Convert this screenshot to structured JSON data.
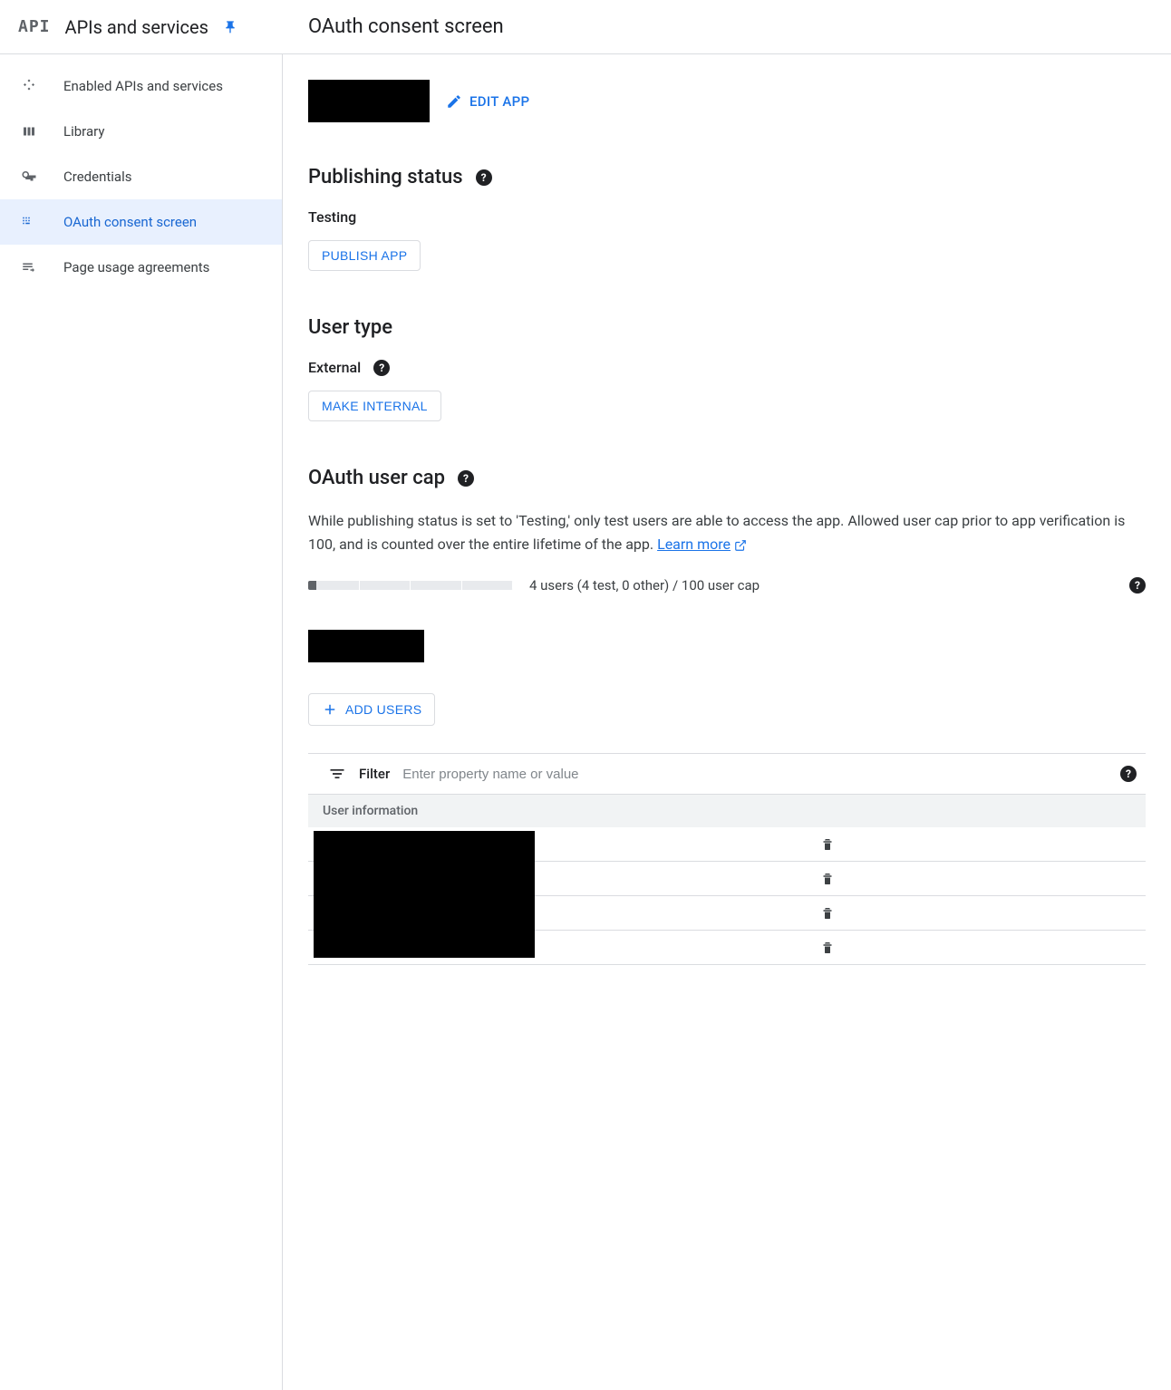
{
  "header": {
    "logo": "API",
    "title": "APIs and services",
    "page_title": "OAuth consent screen"
  },
  "sidebar": {
    "items": [
      {
        "label": "Enabled APIs and services"
      },
      {
        "label": "Library"
      },
      {
        "label": "Credentials"
      },
      {
        "label": "OAuth consent screen"
      },
      {
        "label": "Page usage agreements"
      }
    ]
  },
  "main": {
    "edit_app": "EDIT APP",
    "publishing": {
      "title": "Publishing status",
      "status": "Testing",
      "publish_btn": "PUBLISH APP"
    },
    "user_type": {
      "title": "User type",
      "value": "External",
      "make_internal_btn": "MAKE INTERNAL"
    },
    "user_cap": {
      "title": "OAuth user cap",
      "desc": "While publishing status is set to 'Testing,' only test users are able to access the app. Allowed user cap prior to app verification is 100, and is counted over the entire lifetime of the app. ",
      "learn_more": "Learn more",
      "cap_text": "4 users (4 test, 0 other) / 100 user cap"
    },
    "add_users_btn": "ADD USERS",
    "filter": {
      "label": "Filter",
      "placeholder": "Enter property name or value"
    },
    "table": {
      "header": "User information"
    }
  }
}
